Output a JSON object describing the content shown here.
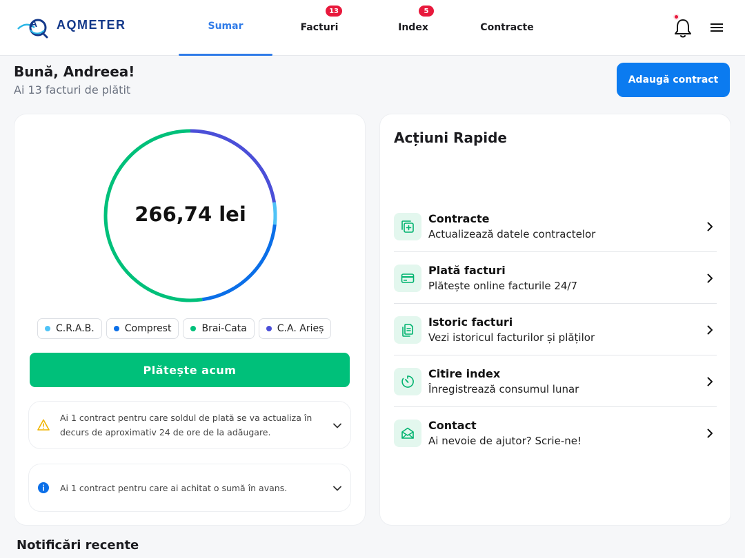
{
  "brand": {
    "logo_text": "AQMETER"
  },
  "nav": {
    "tabs": [
      {
        "label": "Sumar",
        "badge": ""
      },
      {
        "label": "Facturi",
        "badge": "13"
      },
      {
        "label": "Index",
        "badge": "5"
      },
      {
        "label": "Contracte",
        "badge": ""
      }
    ]
  },
  "greeting": {
    "title": "Bună, Andreea!",
    "subtitle": "Ai 13 facturi de plătit"
  },
  "actions": {
    "add_contract": "Adaugă contract"
  },
  "summary": {
    "amount": "266,74 lei",
    "providers": [
      {
        "label": "C.R.A.B.",
        "color": "#4fc3f7"
      },
      {
        "label": "Comprest",
        "color": "#0b6fe8"
      },
      {
        "label": "Brai-Cata",
        "color": "#00c07a"
      },
      {
        "label": "C.A. Arieș",
        "color": "#4b4fd8"
      }
    ],
    "pay_button": "Plătește acum",
    "notices": [
      {
        "text": "Ai 1 contract pentru care soldul de plată se va actualiza în decurs de aproximativ 24 de ore de la adăugare.",
        "icon": "warning-icon"
      },
      {
        "text": "Ai 1 contract pentru care ai achitat o sumă în avans.",
        "icon": "info-icon"
      }
    ]
  },
  "quick_actions": {
    "title": "Acțiuni Rapide",
    "items": [
      {
        "title": "Contracte",
        "desc": "Actualizează datele contractelor",
        "icon": "contracts-icon"
      },
      {
        "title": "Plată facturi",
        "desc": "Plătește online facturile 24/7",
        "icon": "credit-card-icon"
      },
      {
        "title": "Istoric facturi",
        "desc": "Vezi istoricul facturilor și plăților",
        "icon": "documents-icon"
      },
      {
        "title": "Citire index",
        "desc": "Înregistrează consumul lunar",
        "icon": "timer-icon"
      },
      {
        "title": "Contact",
        "desc": "Ai nevoie de ajutor? Scrie-ne!",
        "icon": "mail-icon"
      }
    ]
  },
  "notifications": {
    "title": "Notificări recente"
  },
  "colors": {
    "accent": "#2f7be8",
    "primary_button": "#0b7bf0",
    "pay_button": "#00c07a",
    "badge": "#e8193c"
  }
}
